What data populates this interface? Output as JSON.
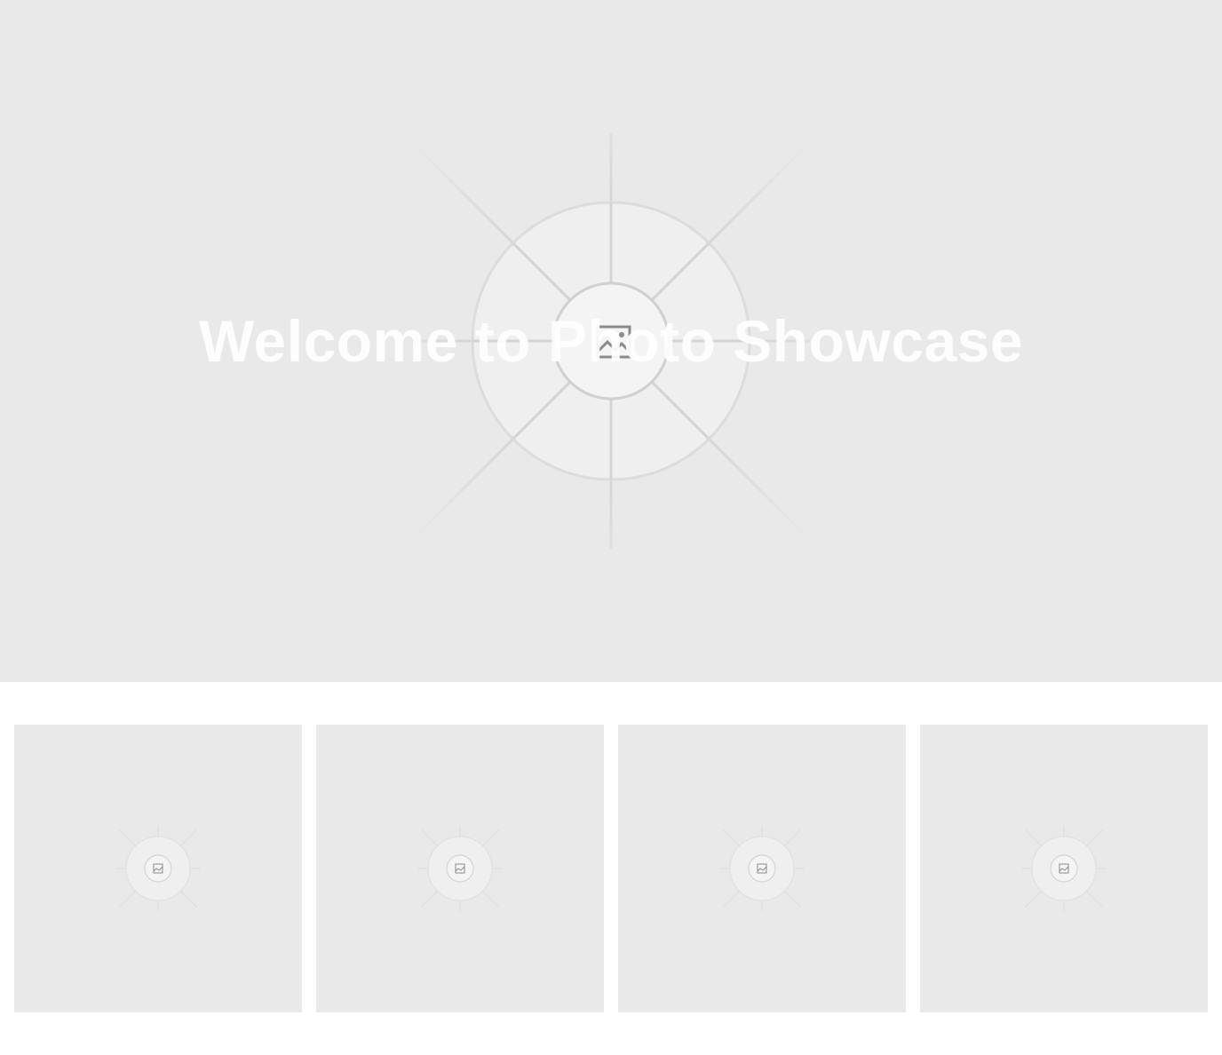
{
  "hero": {
    "title": "Welcome to Photo Showcase",
    "image_icon": "image-placeholder-icon"
  },
  "gallery": {
    "items": [
      {
        "icon": "image-placeholder-icon"
      },
      {
        "icon": "image-placeholder-icon"
      },
      {
        "icon": "image-placeholder-icon"
      },
      {
        "icon": "image-placeholder-icon"
      }
    ]
  },
  "colors": {
    "placeholder_bg": "#e9e9e9",
    "page_bg": "#ffffff",
    "title_text": "#ffffff"
  }
}
